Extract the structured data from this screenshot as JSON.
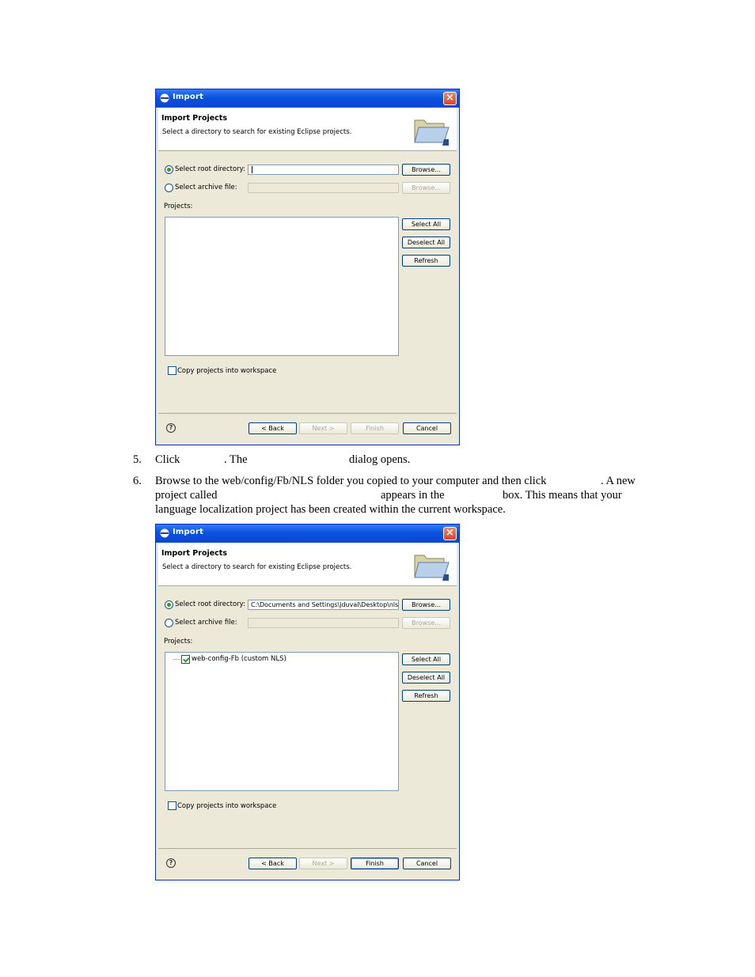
{
  "dialog1": {
    "title": "Import",
    "close": "×",
    "header_title": "Import Projects",
    "header_desc": "Select a directory to search for existing Eclipse projects.",
    "root_dir_label": "Select root directory:",
    "root_dir_value": "",
    "archive_label": "Select archive file:",
    "browse1": "Browse...",
    "browse2": "Browse...",
    "projects_label": "Projects:",
    "select_all": "Select All",
    "deselect_all": "Deselect All",
    "refresh": "Refresh",
    "copy_label": "Copy projects into workspace",
    "back": "< Back",
    "next": "Next >",
    "finish": "Finish",
    "cancel": "Cancel"
  },
  "dialog2": {
    "title": "Import",
    "close": "×",
    "header_title": "Import Projects",
    "header_desc": "Select a directory to search for existing Eclipse projects.",
    "root_dir_label": "Select root directory:",
    "root_dir_value": "C:\\Documents and Settings\\jduval\\Desktop\\nls",
    "archive_label": "Select archive file:",
    "browse1": "Browse...",
    "browse2": "Browse...",
    "projects_label": "Projects:",
    "project_item": "web-config-Fb (custom NLS)",
    "select_all": "Select All",
    "deselect_all": "Deselect All",
    "refresh": "Refresh",
    "copy_label": "Copy projects into workspace",
    "back": "< Back",
    "next": "Next >",
    "finish": "Finish",
    "cancel": "Cancel"
  },
  "steps": {
    "step5_num": "5.",
    "step5_a": "Click",
    "step5_b": ".  The",
    "step5_c": "dialog opens.",
    "step6_num": "6.",
    "step6_line1_a": "Browse to the web/config/Fb/NLS folder you copied to your computer and then click",
    "step6_line1_b": ".  A new",
    "step6_line2_a": "project called",
    "step6_line2_b": "appears in the",
    "step6_line2_c": "box.  This means that your",
    "step6_line3": "language localization project has been created within the current workspace."
  }
}
